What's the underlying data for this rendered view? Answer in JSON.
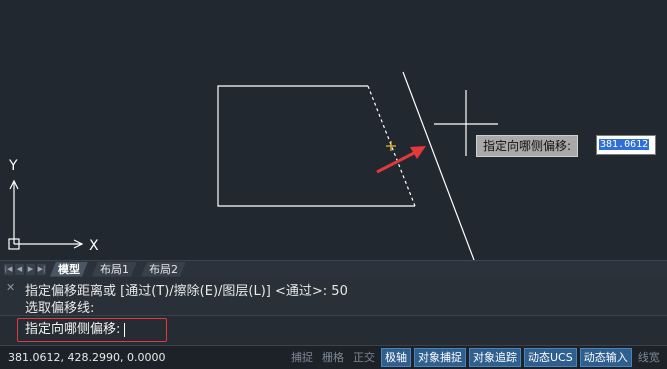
{
  "canvas": {
    "ucs": {
      "y_label": "Y",
      "x_label": "X"
    },
    "tooltip": {
      "prompt": "指定向哪侧偏移:",
      "value": "381.0612"
    }
  },
  "layout_tabs": [
    {
      "label": "模型",
      "active": true
    },
    {
      "label": "布局1",
      "active": false
    },
    {
      "label": "布局2",
      "active": false
    }
  ],
  "command": {
    "history": [
      "指定偏移距离或 [通过(T)/擦除(E)/图层(L)] <通过>: 50",
      "选取偏移线:"
    ],
    "input_prompt": "指定向哪侧偏移:"
  },
  "status": {
    "coordinates": "381.0612, 428.2990, 0.0000",
    "buttons": [
      {
        "label": "捕捉",
        "on": false
      },
      {
        "label": "栅格",
        "on": false
      },
      {
        "label": "正交",
        "on": false
      },
      {
        "label": "极轴",
        "on": true
      },
      {
        "label": "对象捕捉",
        "on": true
      },
      {
        "label": "对象追踪",
        "on": true
      },
      {
        "label": "动态UCS",
        "on": true
      },
      {
        "label": "动态输入",
        "on": true
      },
      {
        "label": "线宽",
        "on": false
      }
    ]
  },
  "colors": {
    "background": "#212830",
    "geometry": "#ffffff",
    "arrow": "#e03a3a",
    "snap_marker": "#e6c229",
    "highlight_box": "#e03a3a"
  }
}
